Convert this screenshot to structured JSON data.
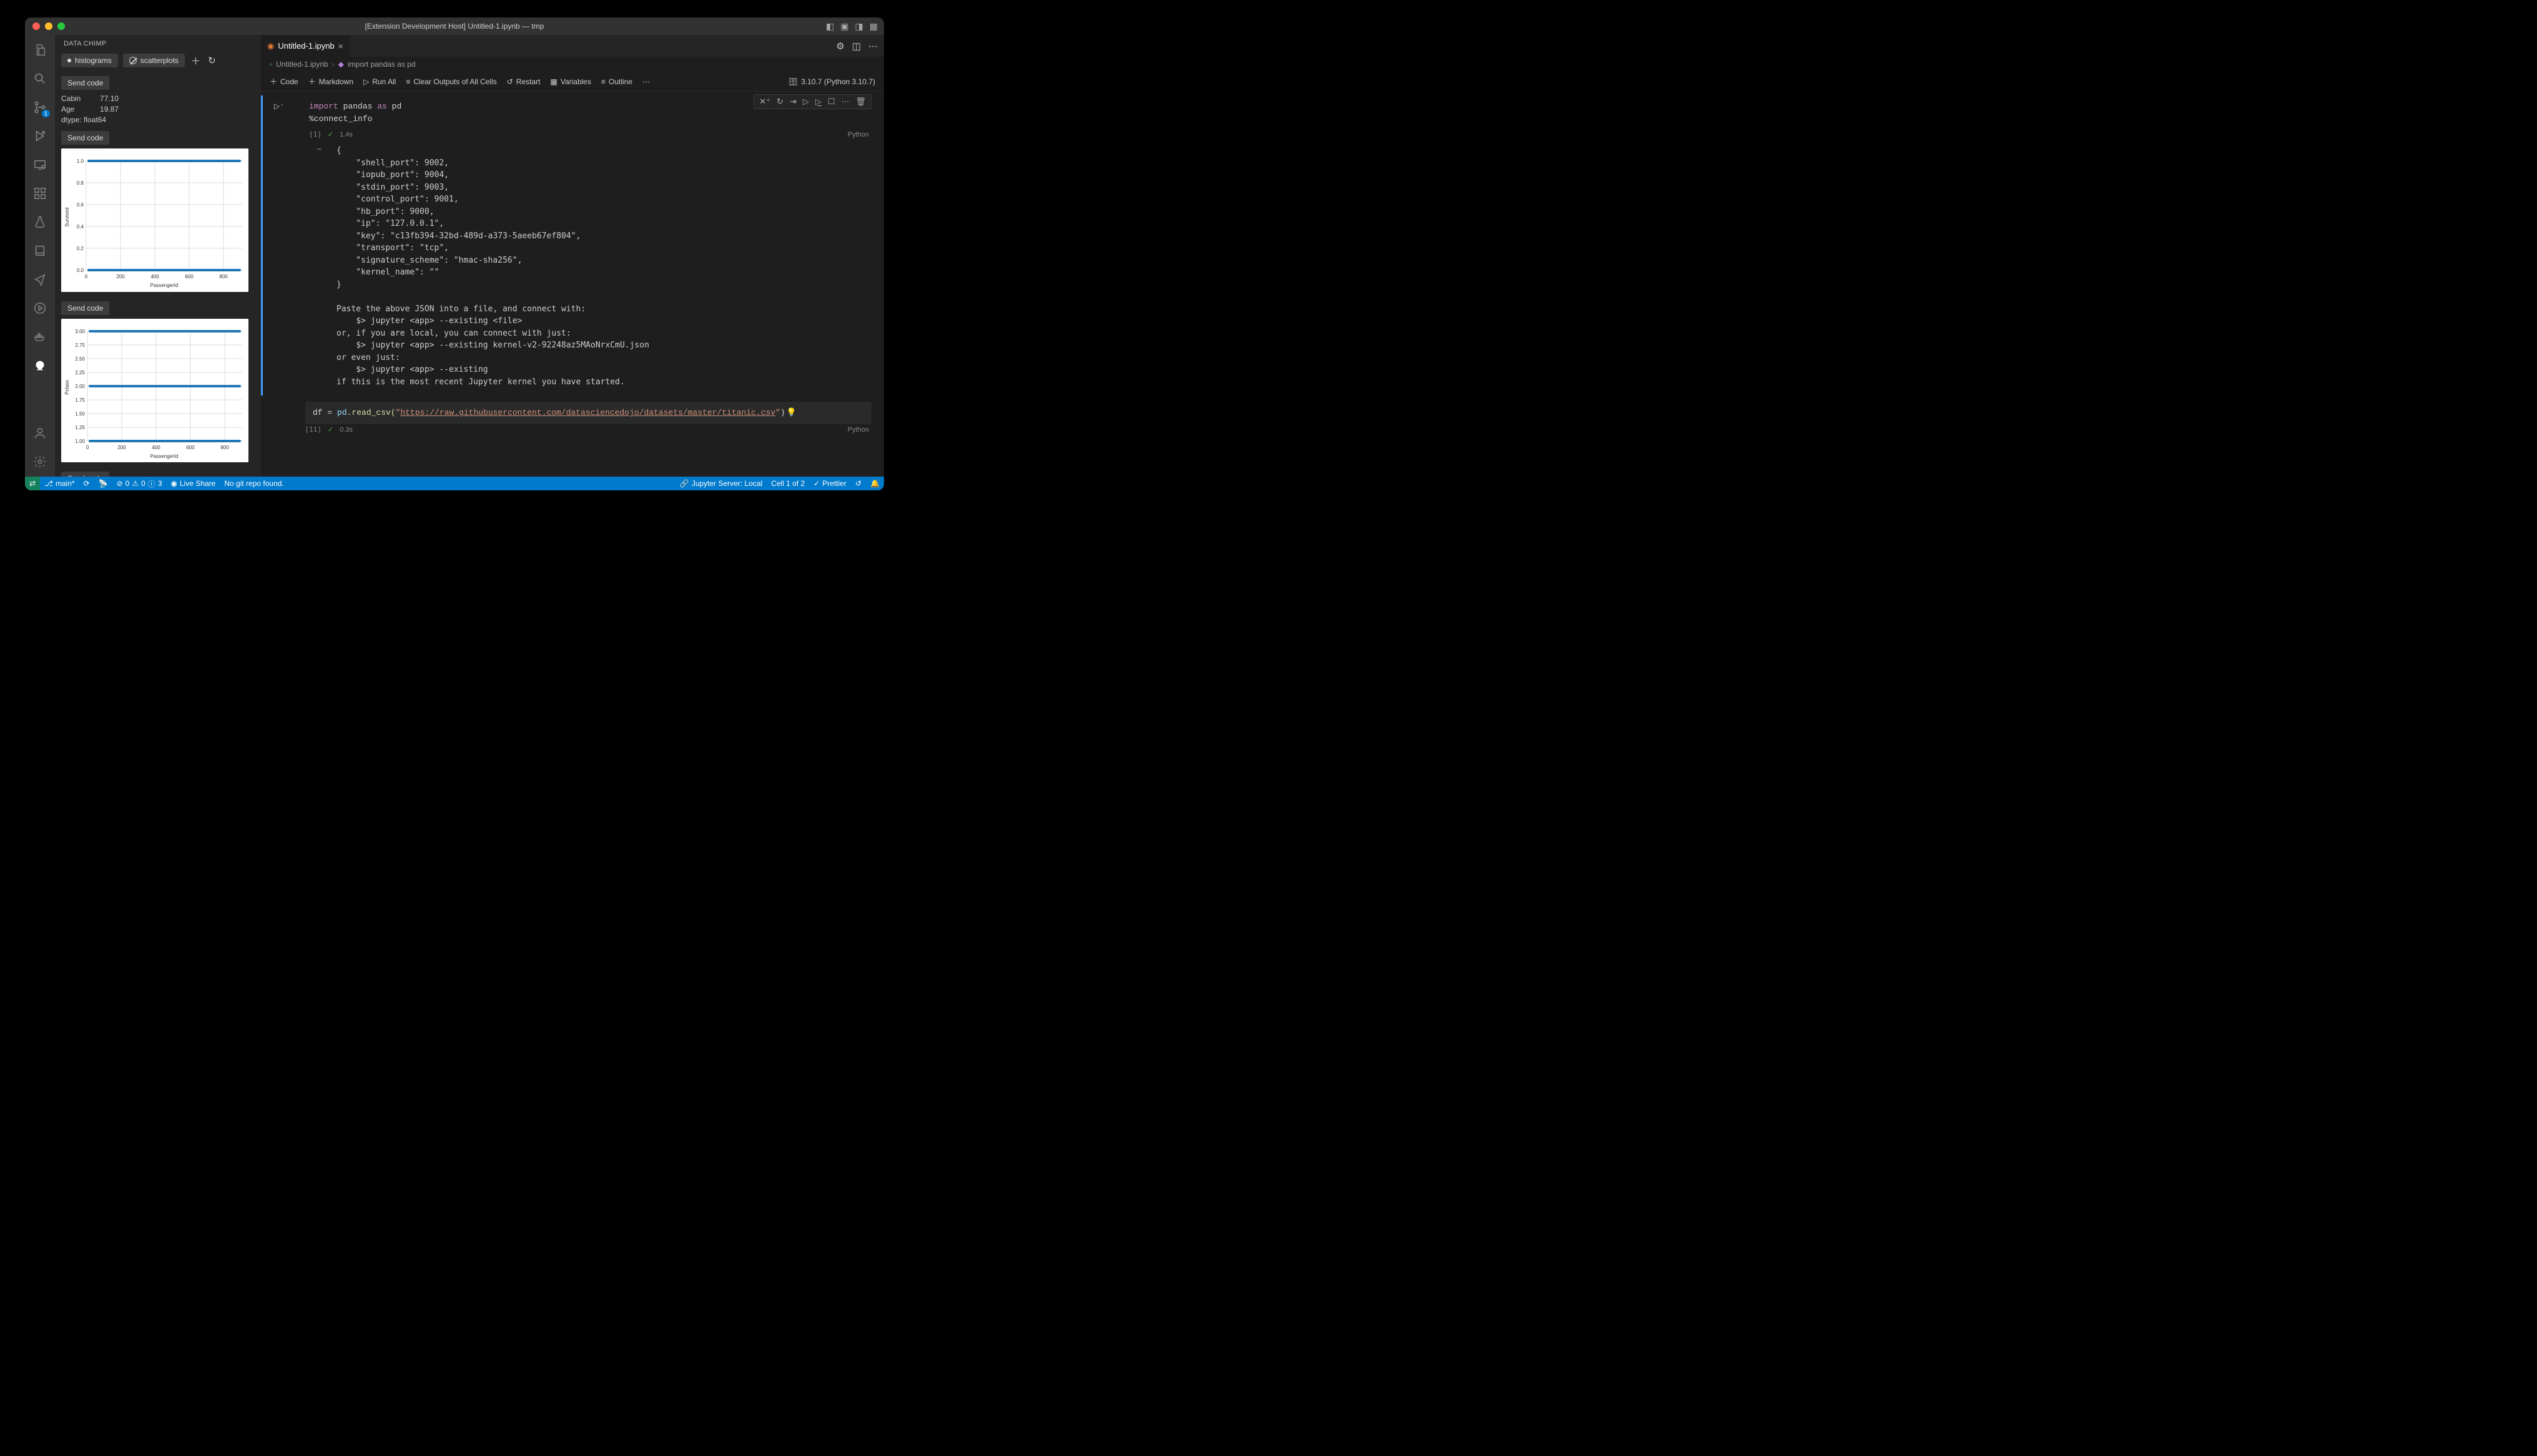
{
  "titlebar": {
    "title": "[Extension Development Host] Untitled-1.ipynb — tmp"
  },
  "activitybar": {
    "badge_scm": "1"
  },
  "sidebar": {
    "header": "DATA CHIMP",
    "tabs": {
      "histograms": "histograms",
      "scatterplots": "scatterplots"
    },
    "send_code": "Send code",
    "stats": {
      "cabin_k": "Cabin",
      "cabin_v": "77.10",
      "age_k": "Age",
      "age_v": "19.87",
      "dtype": "dtype: float64"
    }
  },
  "tab": {
    "name": "Untitled-1.ipynb"
  },
  "breadcrumb": {
    "file": "Untitled-1.ipynb",
    "symbol": "import pandas as pd"
  },
  "nb_toolbar": {
    "code": "Code",
    "markdown": "Markdown",
    "runall": "Run All",
    "clear": "Clear Outputs of All Cells",
    "restart": "Restart",
    "variables": "Variables",
    "outline": "Outline",
    "kernel": "3.10.7 (Python 3.10.7)"
  },
  "cell1": {
    "src_l1_kw": "import",
    "src_l1_mid": " pandas ",
    "src_l1_as": "as",
    "src_l1_end": " pd",
    "src_l2": "%connect_info",
    "idx": "[1]",
    "time": "1.4s",
    "lang": "Python"
  },
  "output1": "{\n    \"shell_port\": 9002,\n    \"iopub_port\": 9004,\n    \"stdin_port\": 9003,\n    \"control_port\": 9001,\n    \"hb_port\": 9000,\n    \"ip\": \"127.0.0.1\",\n    \"key\": \"c13fb394-32bd-489d-a373-5aeeb67ef804\",\n    \"transport\": \"tcp\",\n    \"signature_scheme\": \"hmac-sha256\",\n    \"kernel_name\": \"\"\n}\n\nPaste the above JSON into a file, and connect with:\n    $> jupyter <app> --existing <file>\nor, if you are local, you can connect with just:\n    $> jupyter <app> --existing kernel-v2-92248az5MAoNrxCmU.json\nor even just:\n    $> jupyter <app> --existing\nif this is the most recent Jupyter kernel you have started.",
  "cell2": {
    "pre": "df = ",
    "mod": "pd",
    "fn": ".read_csv(",
    "q1": "\"",
    "url": "https://raw.githubusercontent.com/datasciencedojo/datasets/master/titanic.csv",
    "q2": "\"",
    "post": ")",
    "idx": "[11]",
    "time": "0.3s",
    "lang": "Python"
  },
  "statusbar": {
    "branch": "main*",
    "errors": "0",
    "warnings": "0",
    "info": "3",
    "liveshare": "Live Share",
    "nogit": "No git repo found.",
    "jserver": "Jupyter Server: Local",
    "cell": "Cell 1 of 2",
    "prettier": "Prettier"
  },
  "chart_data": [
    {
      "type": "scatter",
      "title": "",
      "xlabel": "PassengerId",
      "ylabel": "Survived",
      "xlim": [
        0,
        900
      ],
      "ylim": [
        0,
        1.05
      ],
      "xticks": [
        0,
        200,
        400,
        600,
        800
      ],
      "yticks": [
        0.0,
        0.2,
        0.4,
        0.6,
        0.8,
        1.0
      ],
      "series": [
        {
          "name": "Survived",
          "note": "points clustered densely at y=0 and y=1 across PassengerId 1..891 (binary outcome)",
          "x": [
            1,
            891
          ],
          "y_values_present": [
            0,
            1
          ]
        }
      ]
    },
    {
      "type": "scatter",
      "title": "",
      "xlabel": "PassengerId",
      "ylabel": "Pclass",
      "xlim": [
        0,
        900
      ],
      "ylim": [
        1.0,
        3.05
      ],
      "xticks": [
        0,
        200,
        400,
        600,
        800
      ],
      "yticks": [
        1.0,
        1.25,
        1.5,
        1.75,
        2.0,
        2.25,
        2.5,
        2.75,
        3.0
      ],
      "series": [
        {
          "name": "Pclass",
          "note": "points clustered at y=1, y=2, y=3 across PassengerId 1..891",
          "x": [
            1,
            891
          ],
          "y_values_present": [
            1,
            2,
            3
          ]
        }
      ]
    }
  ]
}
